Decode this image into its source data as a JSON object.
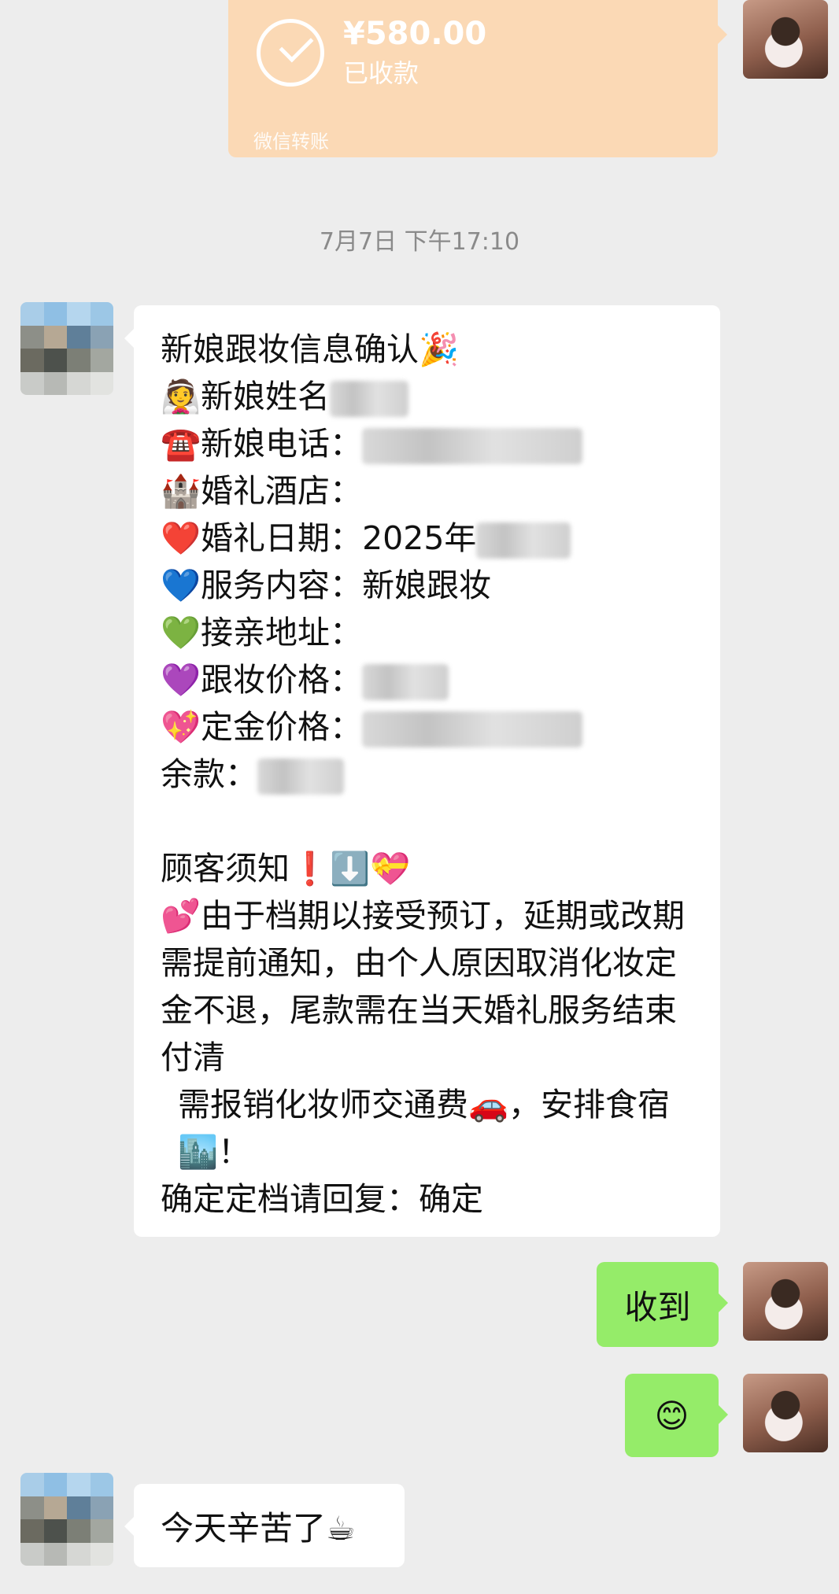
{
  "transfer": {
    "amount": "¥580.00",
    "status": "已收款",
    "type": "微信转账"
  },
  "timestamp": "7月7日 下午17:10",
  "main_message": {
    "title": "新娘跟妆信息确认🎉",
    "name_label": "👰新娘姓名",
    "phone_label": "☎️新娘电话：",
    "hotel_label": "🏰婚礼酒店：",
    "date_label": "❤️婚礼日期：",
    "date_value": "2025年",
    "service_label": "💙服务内容：",
    "service_value": "新娘跟妆",
    "address_label": "💚接亲地址：",
    "price_label": "💜跟妆价格：",
    "deposit_label": "💖定金价格：",
    "balance_label": "余款：",
    "notice_title": "顾客须知❗⬇️💝",
    "notice_body": "💕由于档期以接受预订，延期或改期需提前通知，由个人原因取消化妆定金不退，尾款需在当天婚礼服务结束付清",
    "notice_extra": "需报销化妆师交通费🚗，安排食宿🏙️！",
    "confirm_line": "确定定档请回复：确定"
  },
  "reply_1": "收到",
  "reply_2": "😊",
  "last_message": "今天辛苦了☕",
  "colors": {
    "background": "#ededed",
    "transfer_card": "#fbd9b5",
    "sent_bubble": "#95ec69",
    "received_bubble": "#ffffff",
    "timestamp_text": "#8a8a8a"
  }
}
